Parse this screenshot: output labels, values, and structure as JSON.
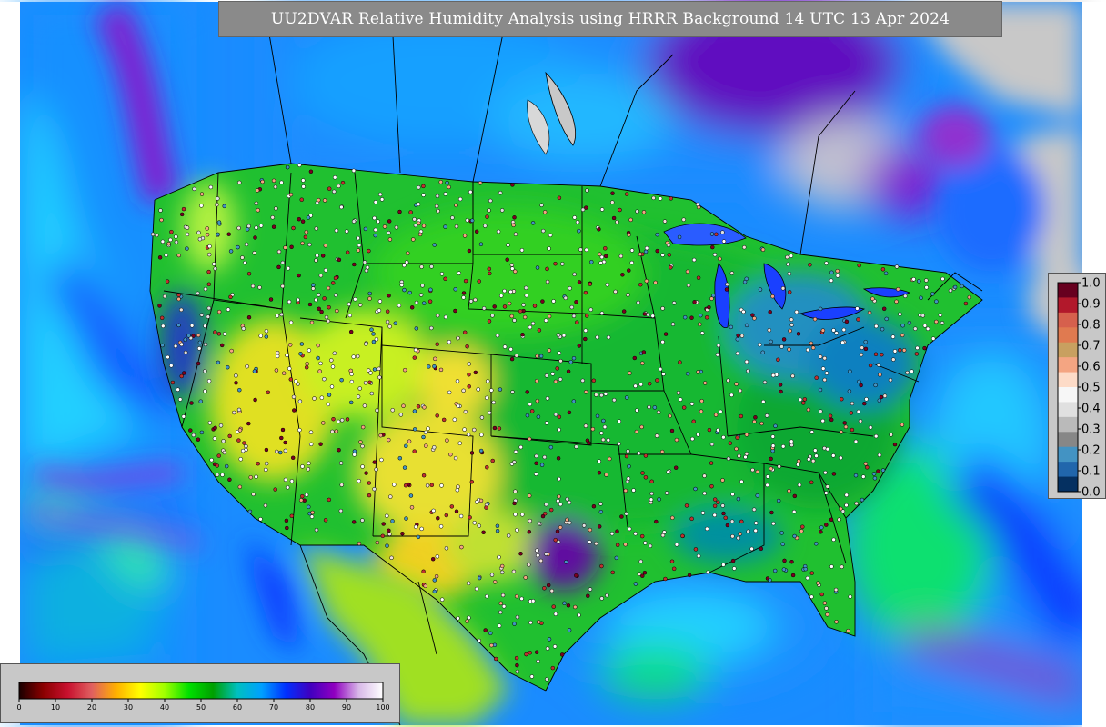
{
  "title": "UU2DVAR Relative Humidity Analysis using HRRR Background 14 UTC 13 Apr 2024",
  "obs_legend": {
    "ticks": [
      "1.0",
      "0.9",
      "0.8",
      "0.7",
      "0.6",
      "0.5",
      "0.4",
      "0.3",
      "0.2",
      "0.1",
      "0.0"
    ],
    "colors": [
      "#67001f",
      "#b2182b",
      "#d6604d",
      "#e07a50",
      "#c8a060",
      "#f4a582",
      "#fddbc7",
      "#f7f7f7",
      "#e0e0e0",
      "#bababa",
      "#878787",
      "#4393c3",
      "#2166ac",
      "#053061"
    ]
  },
  "field_legend": {
    "ticks": [
      "0",
      "10",
      "20",
      "30",
      "40",
      "50",
      "60",
      "70",
      "80",
      "90",
      "100"
    ],
    "colors": [
      "#1a0000",
      "#8b0000",
      "#c8102e",
      "#e06060",
      "#ffb000",
      "#ffff00",
      "#a0ff00",
      "#00e000",
      "#00a000",
      "#00c0c0",
      "#00a0ff",
      "#0030ff",
      "#4000c0",
      "#9000c0",
      "#d8b8e8",
      "#ffffff"
    ]
  },
  "colors": {
    "ocean_blue": "#0a4bff",
    "ocean_cyan": "#1ab0ff",
    "land_green": "#22c040",
    "dry_yellow": "#e8e020",
    "moist_purple": "#8010c0",
    "no_data_gray": "#c8c8c8"
  }
}
